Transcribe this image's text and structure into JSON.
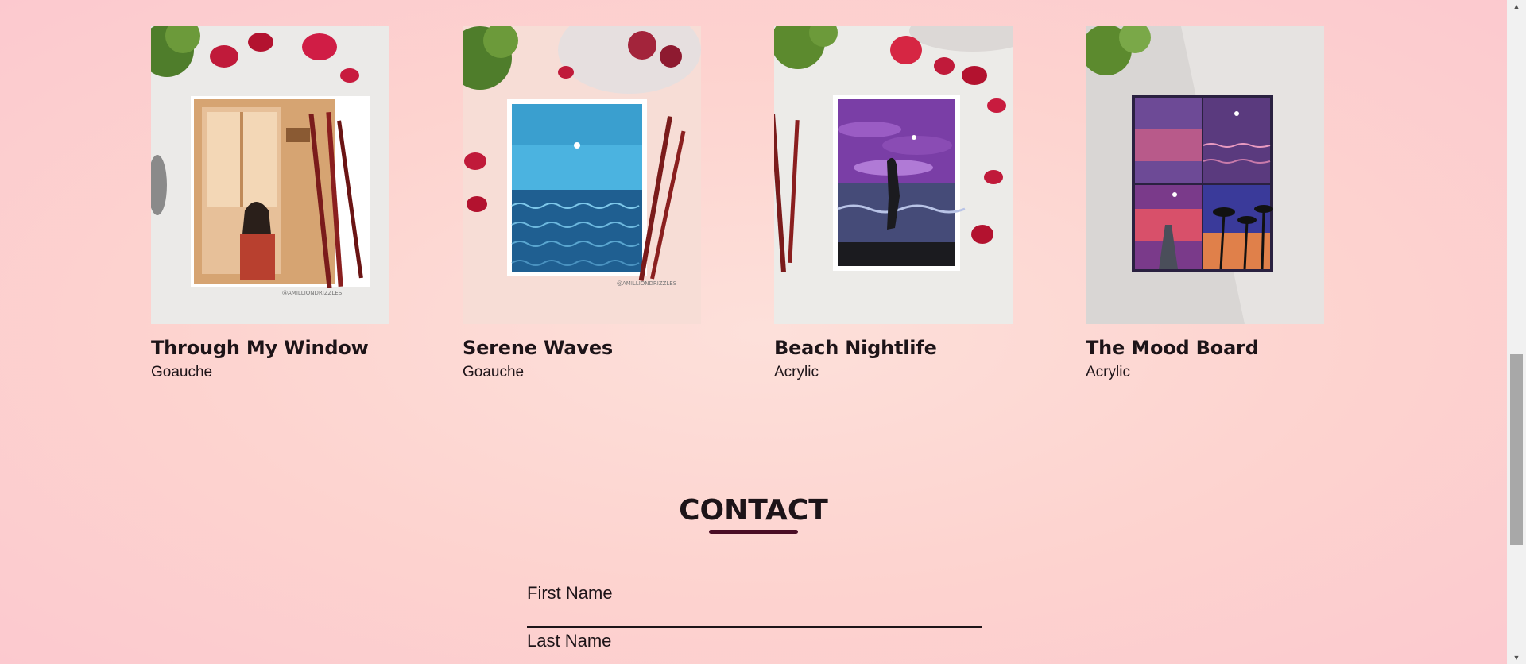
{
  "gallery": {
    "items": [
      {
        "title": "Through My Window",
        "medium": "Goauche",
        "watermark": "@AMILLIONDRIZZLES"
      },
      {
        "title": "Serene Waves",
        "medium": "Goauche",
        "watermark": "@AMILLIONDRIZZLES"
      },
      {
        "title": "Beach Nightlife",
        "medium": "Acrylic"
      },
      {
        "title": "The Mood Board",
        "medium": "Acrylic"
      }
    ]
  },
  "contact": {
    "heading": "CONTACT",
    "first_name_label": "First Name",
    "last_name_label": "Last Name"
  },
  "colors": {
    "accent": "#4a0d25",
    "background": "#fdd8d3",
    "text": "#1d1418"
  }
}
